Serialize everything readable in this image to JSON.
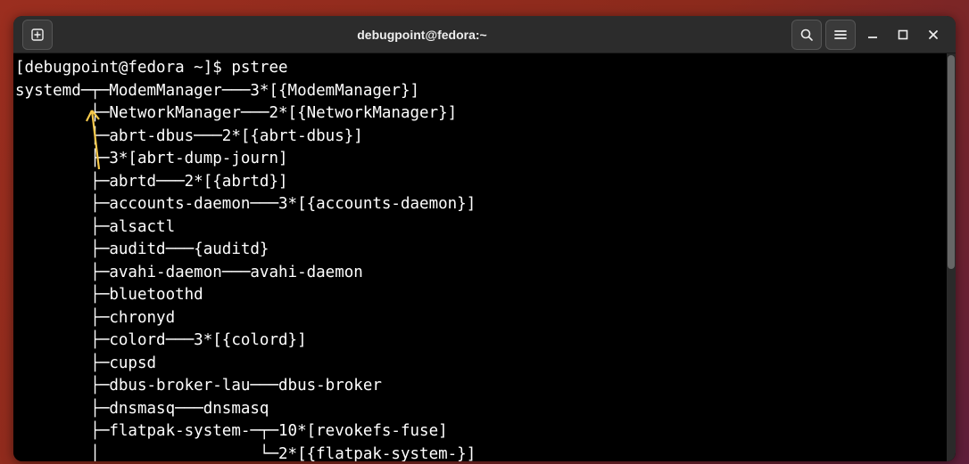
{
  "window": {
    "title": "debugpoint@fedora:~"
  },
  "terminal": {
    "prompt": "[debugpoint@fedora ~]$ ",
    "command": "pstree",
    "output_lines": [
      "systemd─┬─ModemManager───3*[{ModemManager}]",
      "        ├─NetworkManager───2*[{NetworkManager}]",
      "        ├─abrt-dbus───2*[{abrt-dbus}]",
      "        ├─3*[abrt-dump-journ]",
      "        ├─abrtd───2*[{abrtd}]",
      "        ├─accounts-daemon───3*[{accounts-daemon}]",
      "        ├─alsactl",
      "        ├─auditd───{auditd}",
      "        ├─avahi-daemon───avahi-daemon",
      "        ├─bluetoothd",
      "        ├─chronyd",
      "        ├─colord───3*[{colord}]",
      "        ├─cupsd",
      "        ├─dbus-broker-lau───dbus-broker",
      "        ├─dnsmasq───dnsmasq",
      "        ├─flatpak-system-─┬─10*[revokefs-fuse]",
      "        │                 └─2*[{flatpak-system-}]"
    ]
  }
}
